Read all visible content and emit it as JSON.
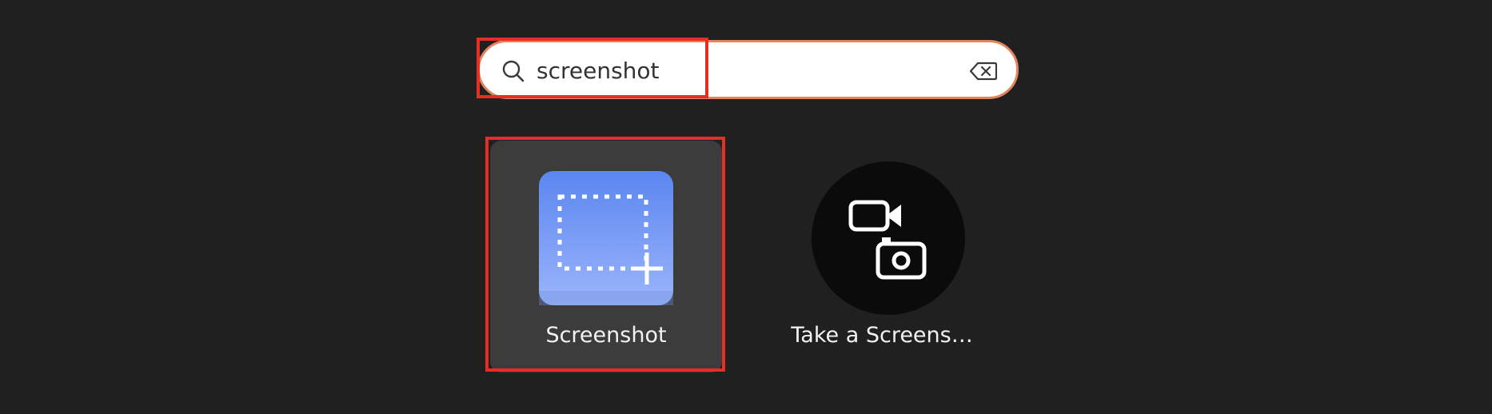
{
  "search": {
    "value": "screenshot",
    "placeholder": ""
  },
  "results": [
    {
      "label": "Screenshot",
      "icon": "screenshot-app-icon",
      "selected": true
    },
    {
      "label": "Take a Screens…",
      "icon": "camera-video-icon",
      "selected": false
    }
  ],
  "colors": {
    "background": "#202020",
    "search_border": "#e3845f",
    "highlight": "#e62e22",
    "selected_tile": "#3c3c3c",
    "screenshot_icon_top": "#5b86f0",
    "screenshot_icon_bottom": "#9bb5fb",
    "take_icon_bg": "#0b0b0b"
  }
}
